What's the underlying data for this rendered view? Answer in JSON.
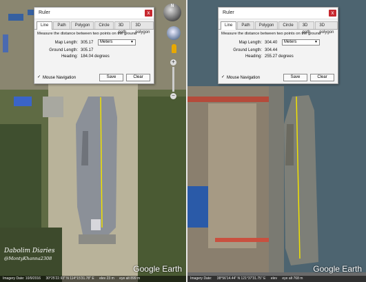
{
  "left": {
    "ruler": {
      "title": "Ruler",
      "close_label": "x",
      "tabs": [
        "Line",
        "Path",
        "Polygon",
        "Circle",
        "3D path",
        "3D polygon"
      ],
      "active_tab": "Line",
      "description": "Measure the distance between two points on the ground",
      "map_length_label": "Map Length:",
      "map_length_value": "305.17",
      "unit": "Meters",
      "ground_length_label": "Ground Length:",
      "ground_length_value": "305.17",
      "heading_label": "Heading:",
      "heading_value": "184.04 degrees",
      "mouse_nav_label": "Mouse Navigation",
      "mouse_nav_checked": "✓",
      "save_label": "Save",
      "clear_label": "Clear"
    },
    "watermark": {
      "line1": "Dabolim Diaries",
      "line2": "@MontyKhanna2308"
    },
    "logo": "Google Earth",
    "status": {
      "imagery_date": "Imagery Date: 10/9/2016",
      "coords": "30°25'22.93\" N  114°15'31.78\" E",
      "elev": "elev  23 m",
      "eye": "eye alt  899 m"
    }
  },
  "right": {
    "ruler": {
      "title": "Ruler",
      "close_label": "x",
      "tabs": [
        "Line",
        "Path",
        "Polygon",
        "Circle",
        "3D path",
        "3D polygon"
      ],
      "active_tab": "Line",
      "description": "Measure the distance between two points on the ground",
      "map_length_label": "Map Length:",
      "map_length_value": "304.40",
      "unit": "Meters",
      "ground_length_label": "Ground Length:",
      "ground_length_value": "304.44",
      "heading_label": "Heading:",
      "heading_value": "255.27 degrees",
      "mouse_nav_label": "Mouse Navigation",
      "mouse_nav_checked": "✓",
      "save_label": "Save",
      "clear_label": "Clear"
    },
    "logo": "Google Earth",
    "status": {
      "imagery_date": "Imagery Date:",
      "coords": "38°56'14.44\" N  121°37'31.75\" E",
      "elev": "elev",
      "eye": "eye alt  768 m"
    }
  },
  "nav": {
    "north_label": "N",
    "zoom_in": "+",
    "zoom_out": "−"
  },
  "colors": {
    "measure_line": "#f2e200",
    "close_red": "#c7282f"
  }
}
